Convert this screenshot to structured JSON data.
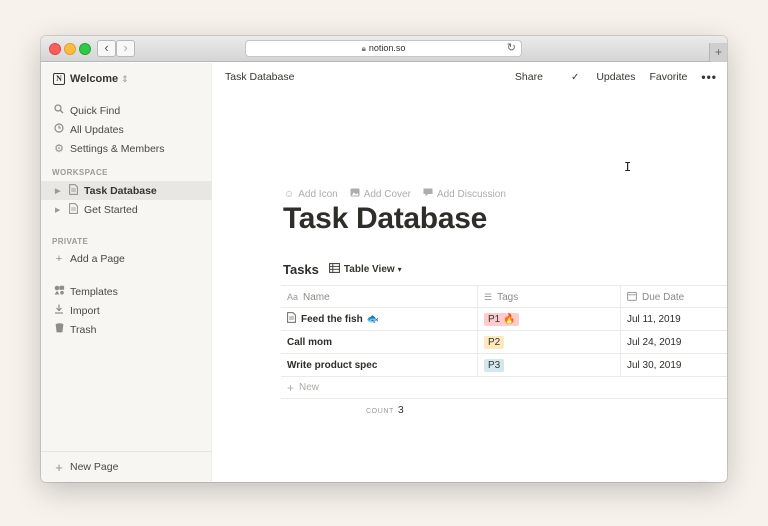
{
  "browser": {
    "url": "notion.so",
    "back_icon": "‹",
    "forward_icon": "›",
    "reload_icon": "↻",
    "new_tab_icon": "+"
  },
  "sidebar": {
    "workspace_name": "Welcome",
    "workspace_logo": "N",
    "nav": [
      {
        "label": "Quick Find",
        "icon": "search-icon"
      },
      {
        "label": "All Updates",
        "icon": "clock-icon"
      },
      {
        "label": "Settings & Members",
        "icon": "gear-icon"
      }
    ],
    "workspace_section": "WORKSPACE",
    "pages": [
      {
        "label": "Task Database",
        "active": true
      },
      {
        "label": "Get Started",
        "active": false
      }
    ],
    "private_section": "PRIVATE",
    "add_page": "Add a Page",
    "tools": [
      {
        "label": "Templates",
        "icon": "templates-icon"
      },
      {
        "label": "Import",
        "icon": "import-icon"
      },
      {
        "label": "Trash",
        "icon": "trash-icon"
      }
    ],
    "new_page": "New Page"
  },
  "topbar": {
    "breadcrumb": "Task Database",
    "share": "Share",
    "updates": "Updates",
    "favorite": "Favorite",
    "more": "•••"
  },
  "page": {
    "add_icon": "Add Icon",
    "add_cover": "Add Cover",
    "add_discussion": "Add Discussion",
    "title": "Task Database"
  },
  "database": {
    "name": "Tasks",
    "view": "Table View",
    "columns": [
      "Name",
      "Tags",
      "Due Date"
    ],
    "rows": [
      {
        "name": "Feed the fish",
        "has_page_icon": true,
        "emoji": "🐟",
        "tag": "P1 🔥",
        "tag_color": "#ffcccd",
        "due": "Jul 11, 2019"
      },
      {
        "name": "Call mom",
        "has_page_icon": false,
        "emoji": "",
        "tag": "P2",
        "tag_color": "#fde9c0",
        "due": "Jul 24, 2019"
      },
      {
        "name": "Write product spec",
        "has_page_icon": false,
        "emoji": "",
        "tag": "P3",
        "tag_color": "#d2e7ee",
        "due": "Jul 30, 2019"
      }
    ],
    "new_row": "New",
    "count_label": "COUNT",
    "count_value": "3"
  },
  "help_button": "?"
}
